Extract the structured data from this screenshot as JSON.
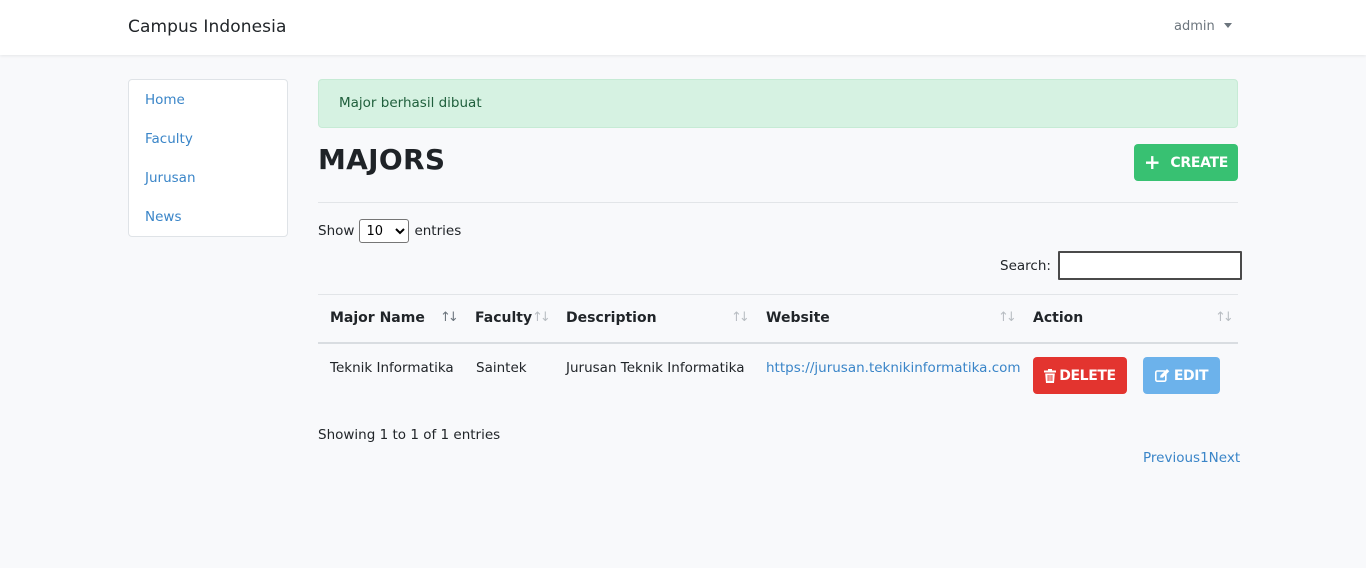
{
  "navbar": {
    "brand": "Campus Indonesia",
    "user": "admin"
  },
  "sidebar": {
    "items": [
      {
        "label": "Home"
      },
      {
        "label": "Faculty"
      },
      {
        "label": "Jurusan"
      },
      {
        "label": "News"
      }
    ]
  },
  "alert": {
    "message": "Major berhasil dibuat"
  },
  "page": {
    "title": "MAJORS",
    "create_label": "CREATE"
  },
  "table_controls": {
    "show_label": "Show",
    "page_size": "10",
    "page_size_options": [
      "10"
    ],
    "entries_label": "entries",
    "search_label": "Search:",
    "search_value": ""
  },
  "table": {
    "columns": [
      "Major Name",
      "Faculty",
      "Description",
      "Website",
      "Action"
    ],
    "rows": [
      {
        "major_name": "Teknik Informatika",
        "faculty": "Saintek",
        "description": "Jurusan Teknik Informatika",
        "website": "https://jurusan.teknikinformatika.com",
        "delete_label": "DELETE",
        "edit_label": "EDIT"
      }
    ]
  },
  "footer": {
    "info": "Showing 1 to 1 of 1 entries",
    "previous": "Previous",
    "page": "1",
    "next": "Next"
  },
  "colors": {
    "accent": "#3a85c8",
    "success": "#38c172",
    "danger": "#e3342f",
    "info": "#6cb2eb",
    "alert_bg": "#d6f2e2"
  },
  "icons": {
    "create": "plus-icon",
    "delete": "trash-icon",
    "edit": "edit-icon",
    "user_menu": "caret-down-icon",
    "sort": "sort-icon"
  }
}
